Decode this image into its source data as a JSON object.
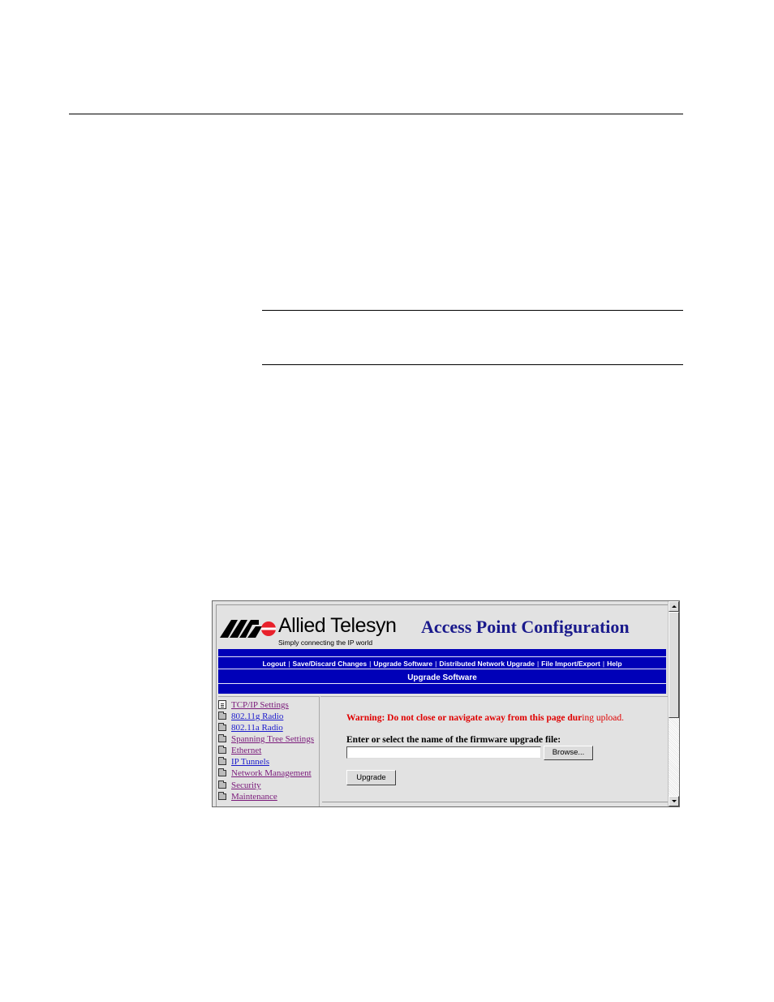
{
  "app": {
    "brand": "Allied Telesyn",
    "tagline": "Simply connecting the IP world",
    "title": "Access Point Configuration"
  },
  "nav": {
    "links": [
      "Logout",
      "Save/Discard Changes",
      "Upgrade Software",
      "Distributed Network Upgrade",
      "File Import/Export",
      "Help"
    ],
    "page_heading": "Upgrade Software"
  },
  "sidebar": {
    "items": [
      {
        "label": "TCP/IP Settings",
        "icon": "document-icon",
        "visited": true
      },
      {
        "label": "802.11g Radio",
        "icon": "folder-icon",
        "visited": false
      },
      {
        "label": "802.11a Radio",
        "icon": "folder-icon",
        "visited": false
      },
      {
        "label": "Spanning Tree Settings",
        "icon": "folder-icon",
        "visited": true
      },
      {
        "label": "Ethernet",
        "icon": "folder-icon",
        "visited": true
      },
      {
        "label": "IP Tunnels",
        "icon": "folder-icon",
        "visited": false
      },
      {
        "label": "Network Management",
        "icon": "folder-icon",
        "visited": true
      },
      {
        "label": "Security",
        "icon": "folder-icon",
        "visited": true
      },
      {
        "label": "Maintenance",
        "icon": "folder-icon",
        "visited": true
      }
    ]
  },
  "content": {
    "warning_bold": "Warning: Do not close or navigate away from this page dur",
    "warning_plain": "ing upload.",
    "file_label": "Enter or select the name of the firmware upgrade file:",
    "file_value": "",
    "browse_label": "Browse...",
    "upgrade_label": "Upgrade"
  },
  "colors": {
    "navbar": "#0000b8",
    "title": "#1a1a8c",
    "warning": "#e00000",
    "logo_red": "#e8202a"
  }
}
